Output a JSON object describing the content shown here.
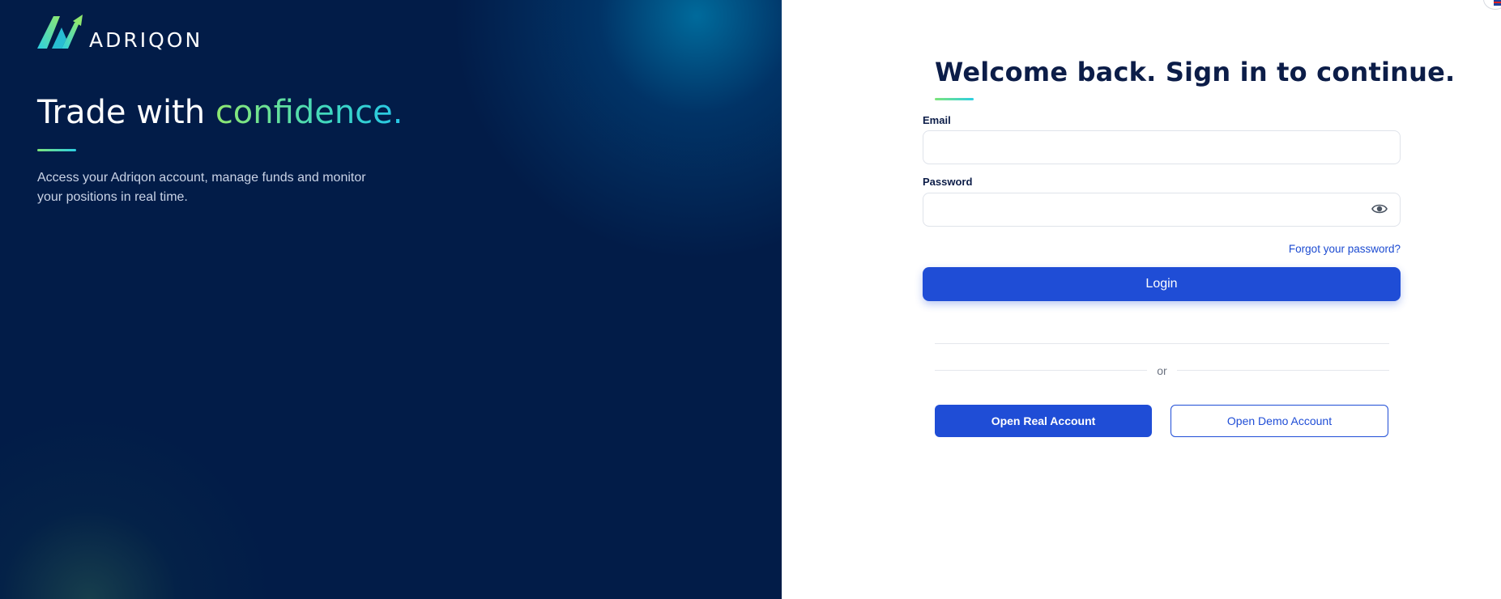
{
  "brand": {
    "logo_text": "ADRIQON",
    "colors": {
      "navy": "#021c48",
      "accent_green": "#8fe870",
      "accent_cyan": "#26c6e8",
      "primary": "#1f4dd6"
    }
  },
  "hero": {
    "headline_prefix": "Trade with ",
    "headline_accent": "confidence.",
    "subtext": "Access your Adriqon account, manage funds and monitor your positions in real time."
  },
  "form": {
    "title": "Welcome back. Sign in to continue.",
    "email_label": "Email",
    "email_value": "",
    "password_label": "Password",
    "password_value": "",
    "show_password_icon": "eye-icon",
    "forgot_link": "Forgot your password?",
    "login_button": "Login",
    "or_text": "or",
    "open_real_button": "Open Real Account",
    "open_demo_button": "Open Demo Account"
  },
  "language": {
    "icon": "uk-flag-icon"
  }
}
